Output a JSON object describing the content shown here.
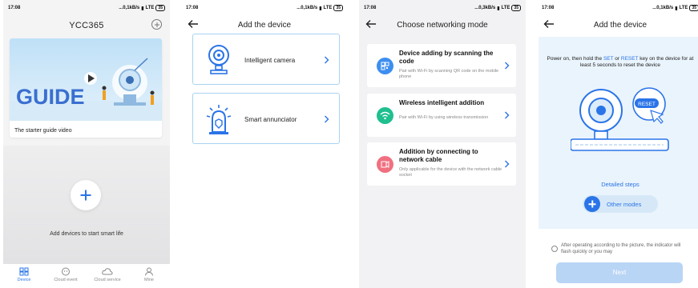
{
  "status_bar": {
    "screens": [
      {
        "time": "17:08",
        "network": "...0,1kB/s",
        "lte": "LTE",
        "battery": "35"
      },
      {
        "time": "17:08",
        "network": "...0,1kB/s",
        "lte": "LTE",
        "battery": "35"
      },
      {
        "time": "17:08",
        "network": "...0,3kB/s",
        "lte": "LTE",
        "battery": "35"
      },
      {
        "time": "17:08",
        "network": "...0,1kB/s",
        "lte": "LTE",
        "battery": "35"
      }
    ]
  },
  "home": {
    "title": "YCC365",
    "guide_banner_text": "GUIDE",
    "guide_caption": "The starter guide video",
    "empty_message": "Add devices to start smart life",
    "tabs": [
      {
        "label": "Device",
        "icon": "grid-icon",
        "active": true
      },
      {
        "label": "Cloud event",
        "icon": "cloud-event-icon",
        "active": false
      },
      {
        "label": "Cloud service",
        "icon": "cloud-icon",
        "active": false
      },
      {
        "label": "Mine",
        "icon": "person-icon",
        "active": false
      }
    ]
  },
  "add_device": {
    "title": "Add the device",
    "items": [
      {
        "label": "Intelligent camera",
        "icon": "camera-icon"
      },
      {
        "label": "Smart annunciator",
        "icon": "alarm-icon"
      }
    ]
  },
  "networking": {
    "title": "Choose networking mode",
    "options": [
      {
        "title": "Device adding by scanning the code",
        "subtitle": "Pair with Wi-Fi by scanning QR code on the mobile phone",
        "icon": "qr-icon",
        "color": "#3d8ef0"
      },
      {
        "title": "Wireless intelligent addition",
        "subtitle": "Pair with Wi-Fi by using wireless transmission",
        "icon": "wifi-icon",
        "color": "#1fbf8f"
      },
      {
        "title": "Addition by connecting to network cable",
        "subtitle": "Only applicable for the device with the network cable socket",
        "icon": "cable-icon",
        "color": "#f07080"
      }
    ]
  },
  "reset": {
    "title": "Add the device",
    "instruction_parts": [
      "Power on, then hold the ",
      "SET",
      " or ",
      "RESET",
      " key on the device for at least 5 seconds to reset the device"
    ],
    "reset_key_label": "RESET",
    "detailed_steps": "Detailed steps",
    "other_modes": "Other modes",
    "confirm_text": "After operating according to the picture, the indicator will flash quickly or you may",
    "next": "Next"
  },
  "colors": {
    "accent": "#2a74e8",
    "card_border": "#a9d3f0",
    "next_disabled": "#b9d5f5"
  }
}
